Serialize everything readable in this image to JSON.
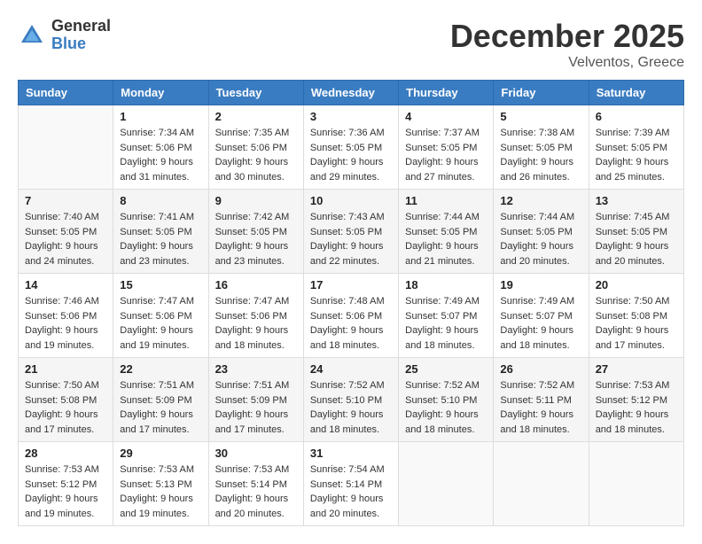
{
  "header": {
    "logo": {
      "general": "General",
      "blue": "Blue"
    },
    "month": "December 2025",
    "location": "Velventos, Greece"
  },
  "weekdays": [
    "Sunday",
    "Monday",
    "Tuesday",
    "Wednesday",
    "Thursday",
    "Friday",
    "Saturday"
  ],
  "weeks": [
    [
      {
        "day": "",
        "sunrise": "",
        "sunset": "",
        "daylight": ""
      },
      {
        "day": "1",
        "sunrise": "Sunrise: 7:34 AM",
        "sunset": "Sunset: 5:06 PM",
        "daylight": "Daylight: 9 hours and 31 minutes."
      },
      {
        "day": "2",
        "sunrise": "Sunrise: 7:35 AM",
        "sunset": "Sunset: 5:06 PM",
        "daylight": "Daylight: 9 hours and 30 minutes."
      },
      {
        "day": "3",
        "sunrise": "Sunrise: 7:36 AM",
        "sunset": "Sunset: 5:05 PM",
        "daylight": "Daylight: 9 hours and 29 minutes."
      },
      {
        "day": "4",
        "sunrise": "Sunrise: 7:37 AM",
        "sunset": "Sunset: 5:05 PM",
        "daylight": "Daylight: 9 hours and 27 minutes."
      },
      {
        "day": "5",
        "sunrise": "Sunrise: 7:38 AM",
        "sunset": "Sunset: 5:05 PM",
        "daylight": "Daylight: 9 hours and 26 minutes."
      },
      {
        "day": "6",
        "sunrise": "Sunrise: 7:39 AM",
        "sunset": "Sunset: 5:05 PM",
        "daylight": "Daylight: 9 hours and 25 minutes."
      }
    ],
    [
      {
        "day": "7",
        "sunrise": "Sunrise: 7:40 AM",
        "sunset": "Sunset: 5:05 PM",
        "daylight": "Daylight: 9 hours and 24 minutes."
      },
      {
        "day": "8",
        "sunrise": "Sunrise: 7:41 AM",
        "sunset": "Sunset: 5:05 PM",
        "daylight": "Daylight: 9 hours and 23 minutes."
      },
      {
        "day": "9",
        "sunrise": "Sunrise: 7:42 AM",
        "sunset": "Sunset: 5:05 PM",
        "daylight": "Daylight: 9 hours and 23 minutes."
      },
      {
        "day": "10",
        "sunrise": "Sunrise: 7:43 AM",
        "sunset": "Sunset: 5:05 PM",
        "daylight": "Daylight: 9 hours and 22 minutes."
      },
      {
        "day": "11",
        "sunrise": "Sunrise: 7:44 AM",
        "sunset": "Sunset: 5:05 PM",
        "daylight": "Daylight: 9 hours and 21 minutes."
      },
      {
        "day": "12",
        "sunrise": "Sunrise: 7:44 AM",
        "sunset": "Sunset: 5:05 PM",
        "daylight": "Daylight: 9 hours and 20 minutes."
      },
      {
        "day": "13",
        "sunrise": "Sunrise: 7:45 AM",
        "sunset": "Sunset: 5:05 PM",
        "daylight": "Daylight: 9 hours and 20 minutes."
      }
    ],
    [
      {
        "day": "14",
        "sunrise": "Sunrise: 7:46 AM",
        "sunset": "Sunset: 5:06 PM",
        "daylight": "Daylight: 9 hours and 19 minutes."
      },
      {
        "day": "15",
        "sunrise": "Sunrise: 7:47 AM",
        "sunset": "Sunset: 5:06 PM",
        "daylight": "Daylight: 9 hours and 19 minutes."
      },
      {
        "day": "16",
        "sunrise": "Sunrise: 7:47 AM",
        "sunset": "Sunset: 5:06 PM",
        "daylight": "Daylight: 9 hours and 18 minutes."
      },
      {
        "day": "17",
        "sunrise": "Sunrise: 7:48 AM",
        "sunset": "Sunset: 5:06 PM",
        "daylight": "Daylight: 9 hours and 18 minutes."
      },
      {
        "day": "18",
        "sunrise": "Sunrise: 7:49 AM",
        "sunset": "Sunset: 5:07 PM",
        "daylight": "Daylight: 9 hours and 18 minutes."
      },
      {
        "day": "19",
        "sunrise": "Sunrise: 7:49 AM",
        "sunset": "Sunset: 5:07 PM",
        "daylight": "Daylight: 9 hours and 18 minutes."
      },
      {
        "day": "20",
        "sunrise": "Sunrise: 7:50 AM",
        "sunset": "Sunset: 5:08 PM",
        "daylight": "Daylight: 9 hours and 17 minutes."
      }
    ],
    [
      {
        "day": "21",
        "sunrise": "Sunrise: 7:50 AM",
        "sunset": "Sunset: 5:08 PM",
        "daylight": "Daylight: 9 hours and 17 minutes."
      },
      {
        "day": "22",
        "sunrise": "Sunrise: 7:51 AM",
        "sunset": "Sunset: 5:09 PM",
        "daylight": "Daylight: 9 hours and 17 minutes."
      },
      {
        "day": "23",
        "sunrise": "Sunrise: 7:51 AM",
        "sunset": "Sunset: 5:09 PM",
        "daylight": "Daylight: 9 hours and 17 minutes."
      },
      {
        "day": "24",
        "sunrise": "Sunrise: 7:52 AM",
        "sunset": "Sunset: 5:10 PM",
        "daylight": "Daylight: 9 hours and 18 minutes."
      },
      {
        "day": "25",
        "sunrise": "Sunrise: 7:52 AM",
        "sunset": "Sunset: 5:10 PM",
        "daylight": "Daylight: 9 hours and 18 minutes."
      },
      {
        "day": "26",
        "sunrise": "Sunrise: 7:52 AM",
        "sunset": "Sunset: 5:11 PM",
        "daylight": "Daylight: 9 hours and 18 minutes."
      },
      {
        "day": "27",
        "sunrise": "Sunrise: 7:53 AM",
        "sunset": "Sunset: 5:12 PM",
        "daylight": "Daylight: 9 hours and 18 minutes."
      }
    ],
    [
      {
        "day": "28",
        "sunrise": "Sunrise: 7:53 AM",
        "sunset": "Sunset: 5:12 PM",
        "daylight": "Daylight: 9 hours and 19 minutes."
      },
      {
        "day": "29",
        "sunrise": "Sunrise: 7:53 AM",
        "sunset": "Sunset: 5:13 PM",
        "daylight": "Daylight: 9 hours and 19 minutes."
      },
      {
        "day": "30",
        "sunrise": "Sunrise: 7:53 AM",
        "sunset": "Sunset: 5:14 PM",
        "daylight": "Daylight: 9 hours and 20 minutes."
      },
      {
        "day": "31",
        "sunrise": "Sunrise: 7:54 AM",
        "sunset": "Sunset: 5:14 PM",
        "daylight": "Daylight: 9 hours and 20 minutes."
      },
      {
        "day": "",
        "sunrise": "",
        "sunset": "",
        "daylight": ""
      },
      {
        "day": "",
        "sunrise": "",
        "sunset": "",
        "daylight": ""
      },
      {
        "day": "",
        "sunrise": "",
        "sunset": "",
        "daylight": ""
      }
    ]
  ]
}
